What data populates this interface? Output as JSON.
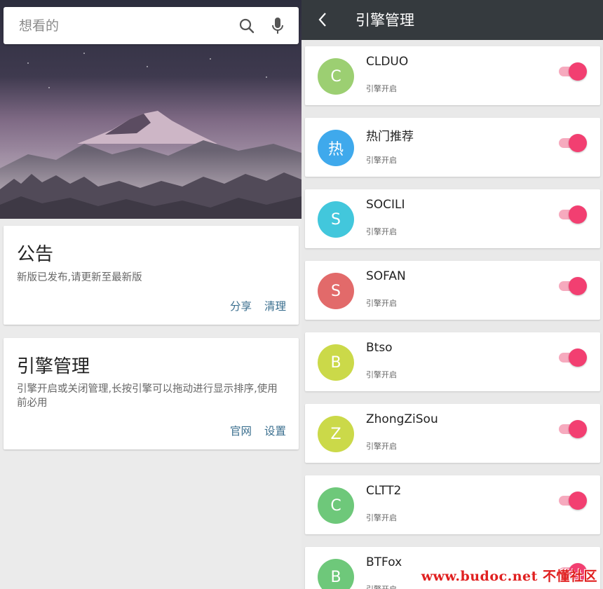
{
  "search": {
    "placeholder": "想看的"
  },
  "announcement": {
    "title": "公告",
    "text": "新版已发布,请更新至最新版",
    "actions": [
      "分享",
      "清理"
    ]
  },
  "engine_card": {
    "title": "引擎管理",
    "text": "引擎开启或关闭管理,长按引擎可以拖动进行显示排序,使用前必用",
    "actions": [
      "官网",
      "设置"
    ]
  },
  "topbar": {
    "title": "引擎管理"
  },
  "engines": [
    {
      "letter": "C",
      "name": "CLDUO",
      "status": "引擎开启",
      "color": "#9ccf72",
      "enabled": true
    },
    {
      "letter": "热",
      "name": "热门推荐",
      "status": "引擎开启",
      "color": "#3fa9ec",
      "enabled": true
    },
    {
      "letter": "S",
      "name": "SOCILI",
      "status": "引擎开启",
      "color": "#42c7dc",
      "enabled": true
    },
    {
      "letter": "S",
      "name": "SOFAN",
      "status": "引擎开启",
      "color": "#e26a6a",
      "enabled": true
    },
    {
      "letter": "B",
      "name": "Btso",
      "status": "引擎开启",
      "color": "#cbd949",
      "enabled": true
    },
    {
      "letter": "Z",
      "name": "ZhongZiSou",
      "status": "引擎开启",
      "color": "#cbd949",
      "enabled": true
    },
    {
      "letter": "C",
      "name": "CLTT2",
      "status": "引擎开启",
      "color": "#6ec87a",
      "enabled": true
    },
    {
      "letter": "B",
      "name": "BTFox",
      "status": "引擎开启",
      "color": "#6ec87a",
      "enabled": true
    }
  ],
  "watermark": "www.budoc.net 不懂社区",
  "colors": {
    "accent": "#f23f71",
    "topbar": "#353a3e",
    "link": "#3b6f8f"
  }
}
